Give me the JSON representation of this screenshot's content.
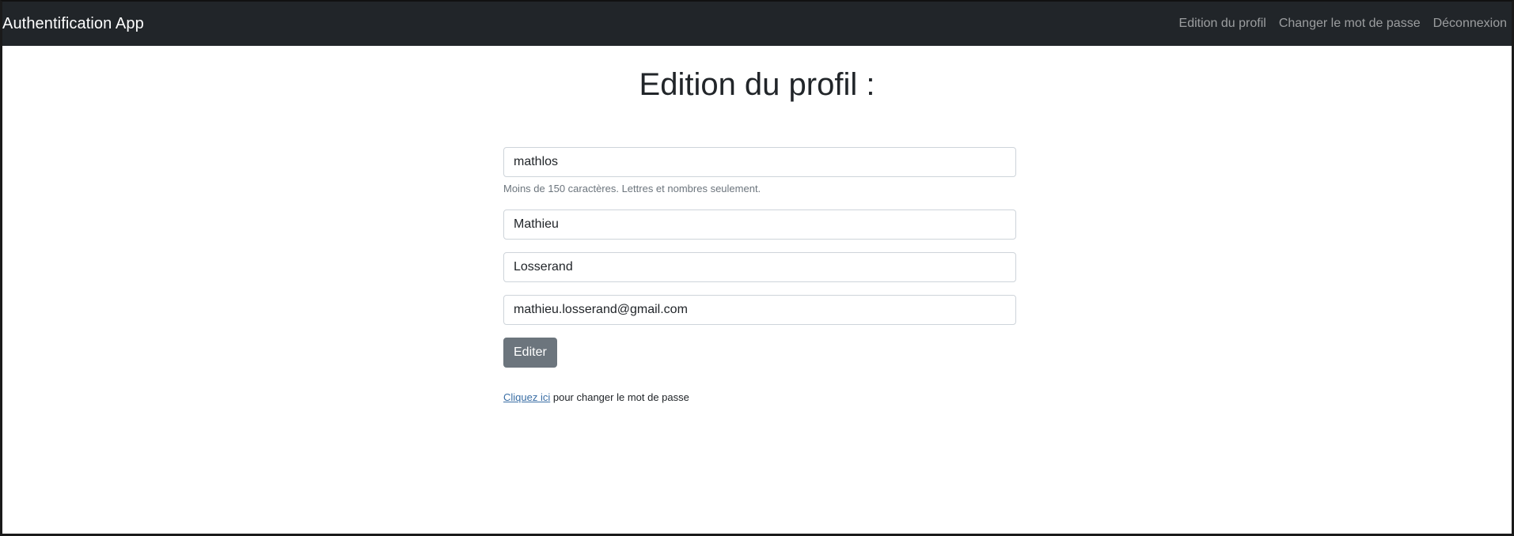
{
  "navbar": {
    "brand": "Authentification App",
    "links": [
      {
        "label": "Edition du profil"
      },
      {
        "label": "Changer le mot de passe"
      },
      {
        "label": "Déconnexion"
      }
    ]
  },
  "page": {
    "title": "Edition du profil :"
  },
  "form": {
    "username": {
      "value": "mathlos",
      "help": "Moins de 150 caractères. Lettres et nombres seulement."
    },
    "first_name": {
      "value": "Mathieu"
    },
    "last_name": {
      "value": "Losserand"
    },
    "email": {
      "value": "mathieu.losserand@gmail.com"
    },
    "submit_label": "Editer"
  },
  "footer": {
    "link_text": "Cliquez ici",
    "rest_text": " pour changer le mot de passe"
  },
  "colors": {
    "navbar_bg": "#212529",
    "button_bg": "#6c757d",
    "link": "#3a6ea5"
  }
}
